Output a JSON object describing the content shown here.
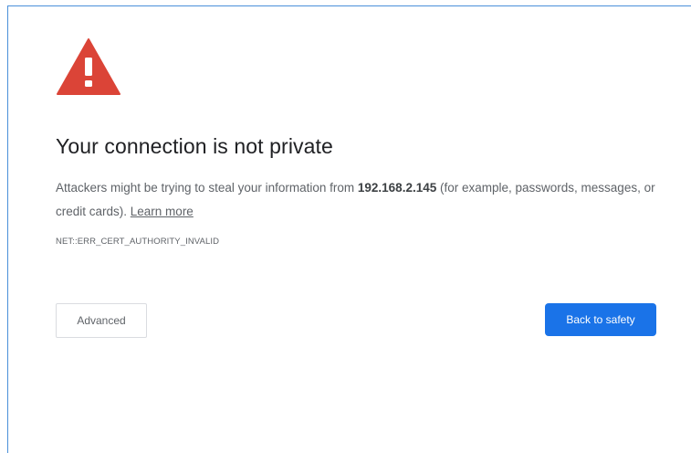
{
  "interstitial": {
    "icon": "warning-triangle-icon",
    "icon_color": "#db4437",
    "title": "Your connection is not private",
    "message_before": "Attackers might be trying to steal your information from ",
    "host": "192.168.2.145",
    "message_after": " (for example, passwords, messages, or credit cards). ",
    "learn_more": "Learn more",
    "error_code": "NET::ERR_CERT_AUTHORITY_INVALID"
  },
  "buttons": {
    "advanced_label": "Advanced",
    "back_to_safety_label": "Back to safety",
    "primary_color": "#1a73e8"
  }
}
